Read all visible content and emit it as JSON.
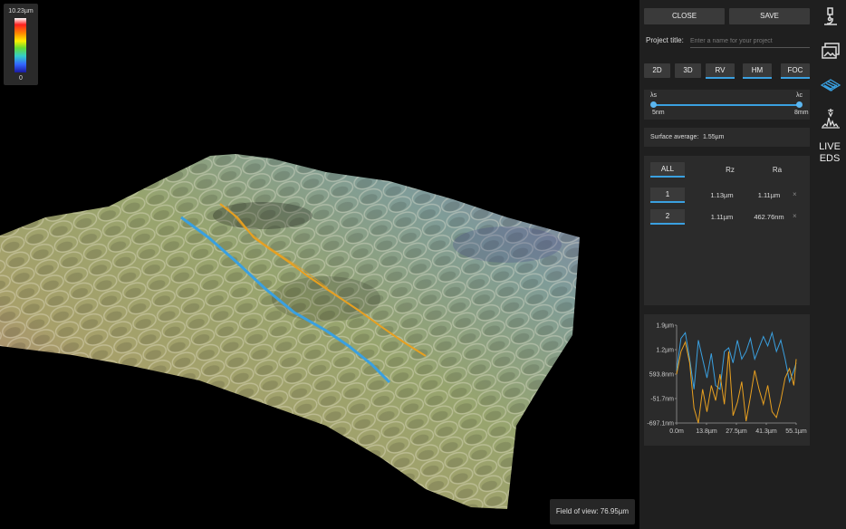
{
  "colorbar": {
    "max": "10.23µm",
    "min": "0"
  },
  "viewer": {
    "field_of_view": "Field of view: 76.95µm"
  },
  "toolbar": {
    "close": "CLOSE",
    "save": "SAVE"
  },
  "project": {
    "label": "Project title:",
    "placeholder": "Enter a name for your project"
  },
  "modes": [
    {
      "label": "2D",
      "active": false
    },
    {
      "label": "3D",
      "active": false
    },
    {
      "label": "RV",
      "active": true
    },
    {
      "label": "HM",
      "active": true
    },
    {
      "label": "FOC",
      "active": true
    }
  ],
  "filter": {
    "lambda_s": "λs",
    "lambda_c": "λc",
    "min": "5nm",
    "max": "8mm"
  },
  "surface": {
    "label": "Surface average:",
    "value": "1.55µm"
  },
  "table": {
    "all": "ALL",
    "col_rz": "Rz",
    "col_ra": "Ra",
    "rows": [
      {
        "id": "1",
        "rz": "1.13µm",
        "ra": "1.11µm",
        "remove": "×"
      },
      {
        "id": "2",
        "rz": "1.11µm",
        "ra": "462.76nm",
        "remove": "×"
      }
    ]
  },
  "chart_data": {
    "type": "line",
    "y_ticks": [
      "1.9µm",
      "1.2µm",
      "593.8nm",
      "-51.7nm",
      "-697.1nm"
    ],
    "x_ticks": [
      "0.0m",
      "13.8µm",
      "27.5µm",
      "41.3µm",
      "55.1µm"
    ],
    "ylim": [
      -697.1,
      1900
    ],
    "xlim": [
      0,
      55.1
    ],
    "series": [
      {
        "color": "#3aa0e0",
        "x": [
          0,
          2,
          4,
          6,
          8,
          10,
          12,
          14,
          16,
          18,
          20,
          22,
          24,
          26,
          28,
          30,
          32,
          34,
          36,
          38,
          40,
          42,
          44,
          46,
          48,
          50,
          52,
          54,
          55.1
        ],
        "values": [
          700,
          1550,
          1700,
          1000,
          200,
          1500,
          1000,
          500,
          1150,
          300,
          200,
          1200,
          1300,
          900,
          1500,
          1000,
          1200,
          1550,
          1000,
          1300,
          1600,
          1350,
          1700,
          1200,
          1500,
          1000,
          400,
          700,
          900
        ]
      },
      {
        "color": "#e8a020",
        "x": [
          0,
          2,
          4,
          6,
          8,
          10,
          12,
          14,
          16,
          18,
          20,
          22,
          24,
          26,
          28,
          30,
          32,
          34,
          36,
          38,
          40,
          42,
          44,
          46,
          48,
          50,
          52,
          54,
          55.1
        ],
        "values": [
          600,
          1200,
          1450,
          900,
          -300,
          -700,
          200,
          -400,
          300,
          -100,
          600,
          -200,
          1200,
          -500,
          -150,
          400,
          -650,
          0,
          700,
          200,
          -200,
          300,
          -400,
          -550,
          -100,
          500,
          750,
          300,
          1000
        ]
      }
    ]
  },
  "rail": {
    "icons": [
      "microscope-icon",
      "gallery-icon",
      "surface-map-icon",
      "eds-spectrum-icon"
    ],
    "live": "LIVE",
    "eds": "EDS"
  }
}
